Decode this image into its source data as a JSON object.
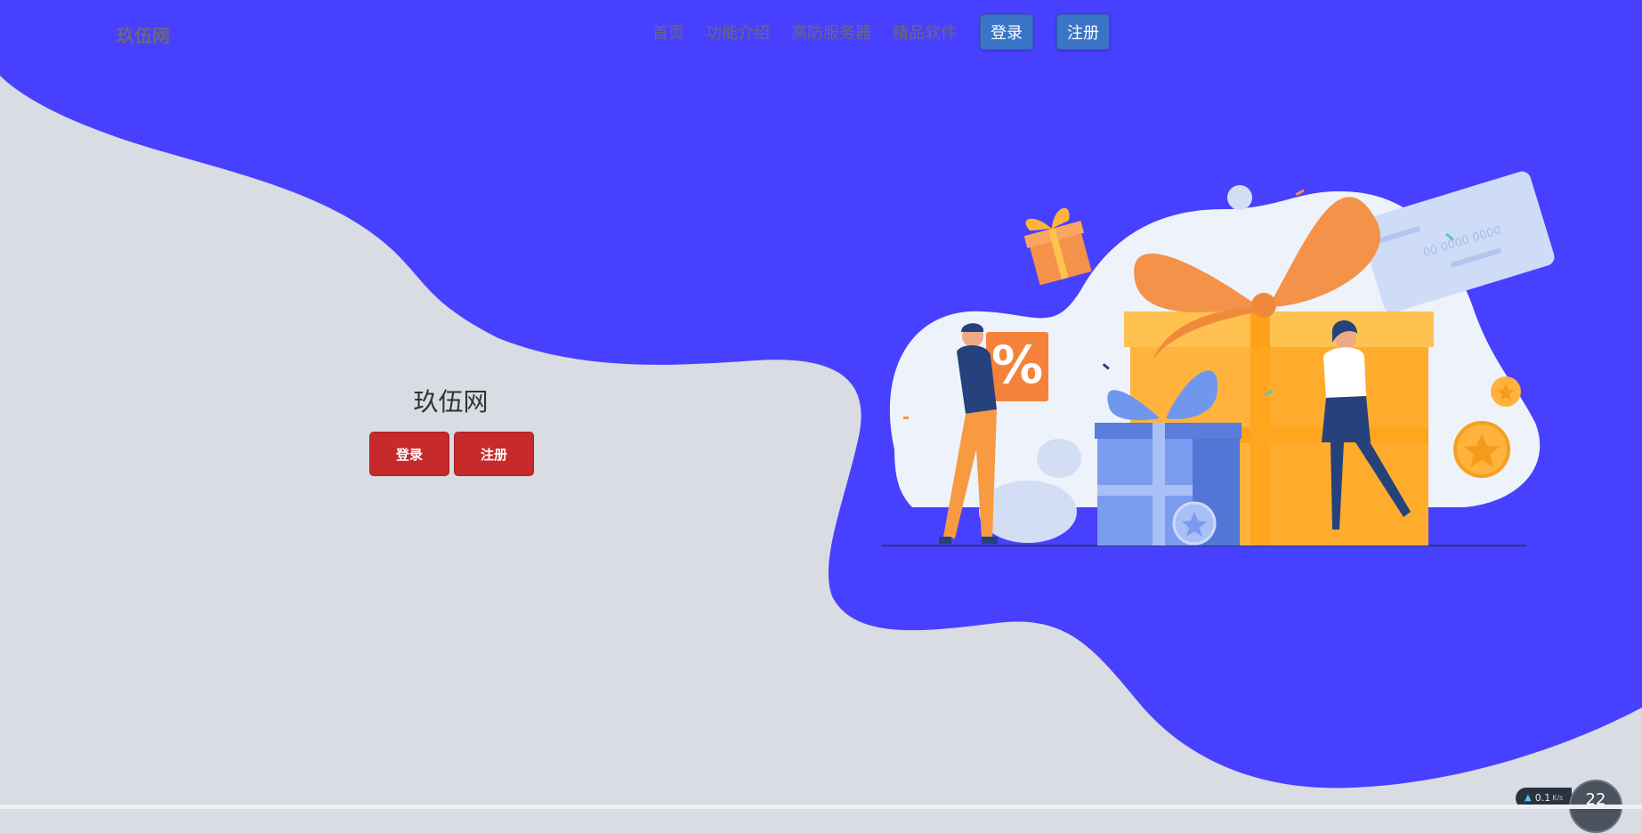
{
  "header": {
    "brand": "玖伍网",
    "nav": [
      "首页",
      "功能介绍",
      "高防服务器",
      "精品软件"
    ],
    "login_label": "登录",
    "register_label": "注册"
  },
  "hero": {
    "title": "玖伍网",
    "login_label": "登录",
    "register_label": "注册"
  },
  "illustration": {
    "percent_sign": "%",
    "card_number": "00 0000 0000"
  },
  "net_widget": {
    "speed_value": "0.1",
    "speed_unit": "K/s",
    "gauge_value": "22"
  },
  "colors": {
    "accent": "#4840ff",
    "background": "#d9dce3",
    "hero_button": "#c62a2a",
    "nav_button": "#3a74c6"
  }
}
